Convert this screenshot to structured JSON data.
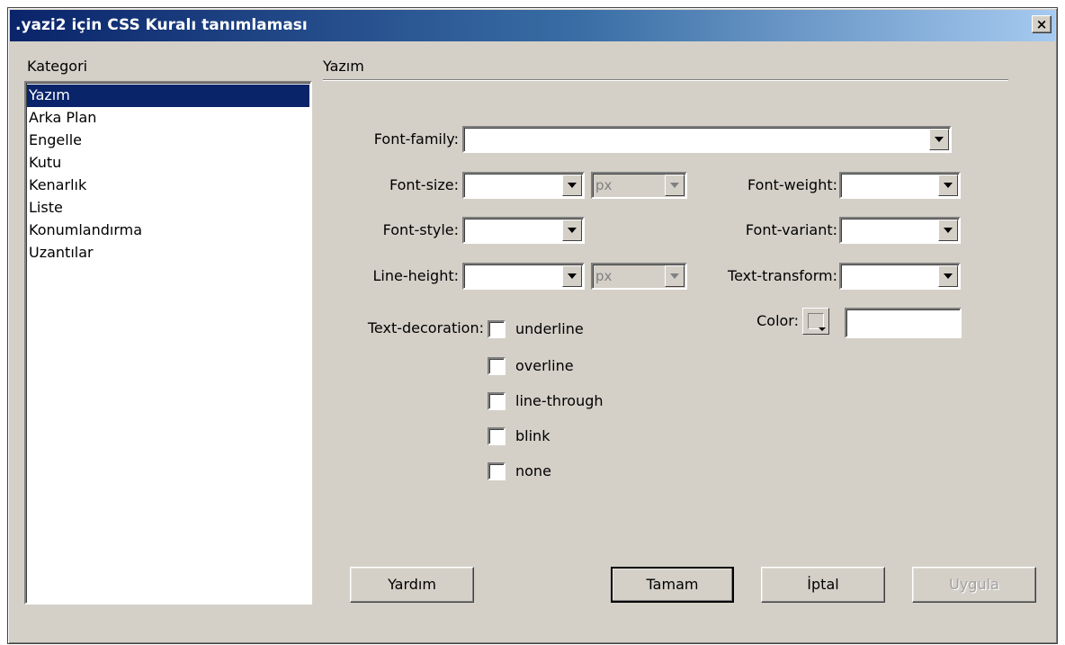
{
  "window": {
    "title": ".yazi2 için CSS Kuralı tanımlaması",
    "close_label": "×"
  },
  "category": {
    "label": "Kategori",
    "items": [
      "Yazım",
      "Arka Plan",
      "Engelle",
      "Kutu",
      "Kenarlık",
      "Liste",
      "Konumlandırma",
      "Uzantılar"
    ],
    "selected": "Yazım"
  },
  "section": {
    "title": "Yazım"
  },
  "fields": {
    "font_family": {
      "label": "Font-family:",
      "value": ""
    },
    "font_size": {
      "label": "Font-size:",
      "value": "",
      "unit": "px"
    },
    "font_weight": {
      "label": "Font-weight:",
      "value": ""
    },
    "font_style": {
      "label": "Font-style:",
      "value": ""
    },
    "font_variant": {
      "label": "Font-variant:",
      "value": ""
    },
    "line_height": {
      "label": "Line-height:",
      "value": "",
      "unit": "px"
    },
    "text_transform": {
      "label": "Text-transform:",
      "value": ""
    },
    "color": {
      "label": "Color:",
      "value": ""
    },
    "text_decoration": {
      "label": "Text-decoration:",
      "options": [
        "underline",
        "overline",
        "line-through",
        "blink",
        "none"
      ]
    }
  },
  "buttons": {
    "help": "Yardım",
    "ok": "Tamam",
    "cancel": "İptal",
    "apply": "Uygula"
  }
}
